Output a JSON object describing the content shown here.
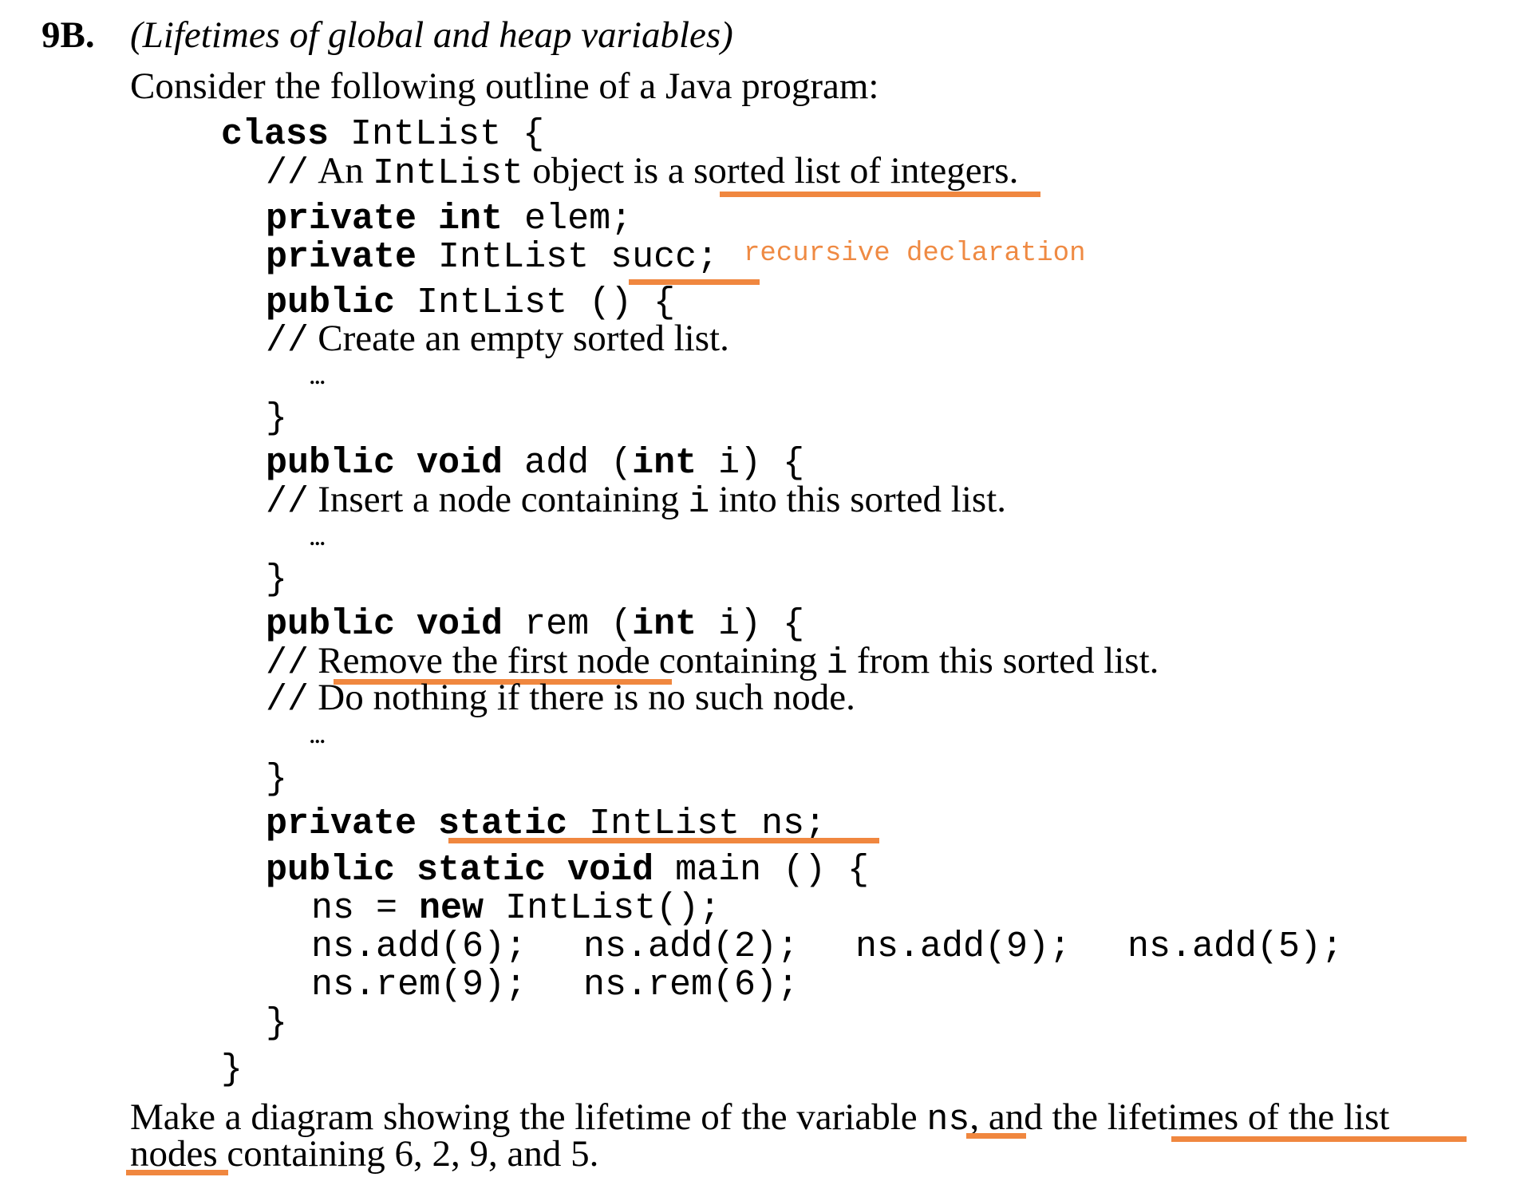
{
  "heading": {
    "number": "9B.",
    "title": "(Lifetimes of global and heap variables)",
    "intro": "Consider the following outline of a Java program:"
  },
  "code": {
    "class_kw": "class",
    "class_name": "IntList {",
    "comment_prefix": "//",
    "class_comment": {
      "a": "An",
      "mono": "IntList",
      "b": "object is a",
      "u": "sorted list of integers."
    },
    "field_elem": {
      "kw": "private int",
      "rest": "elem;"
    },
    "field_succ": {
      "kw": "private",
      "type": "IntList",
      "name": "succ;"
    },
    "annotation_succ": "recursive declaration",
    "ctor": {
      "kw": "public",
      "rest": "IntList () {"
    },
    "ctor_comment": "Create an empty sorted list.",
    "ellipsis": "...",
    "close_brace": "}",
    "add": {
      "kw": "public void",
      "name": "add",
      "lp": "(",
      "param_kw": "int",
      "rest": "i) {"
    },
    "add_comment": {
      "a": "Insert a node containing",
      "mono": "i",
      "b": "into this sorted list."
    },
    "rem": {
      "kw": "public void",
      "name": "rem",
      "lp": "(",
      "param_kw": "int",
      "rest": "i) {"
    },
    "rem_comment1": {
      "u": "Remove the first node",
      "a": "containing",
      "mono": "i",
      "b": "from this sorted list."
    },
    "rem_comment2": "Do nothing if there is no such node.",
    "ns_decl": {
      "kw1": "private",
      "kw2": "static",
      "rest": "IntList ns;"
    },
    "main": {
      "kw": "public static void",
      "rest": "main () {"
    },
    "main_line1": {
      "a": "ns =",
      "kw": "new",
      "b": "IntList();"
    },
    "main_line2": [
      "ns.add(6);",
      "ns.add(2);",
      "ns.add(9);",
      "ns.add(5);"
    ],
    "main_line3": [
      "ns.rem(9);",
      "ns.rem(6);"
    ]
  },
  "question": {
    "l1a": "Make a diagram showing the lifetime of the variable",
    "l1mono": "ns",
    "l1b": ", and the",
    "l1u": "lifetimes of the list",
    "l2u": "nodes",
    "l2b": "containing 6, 2, 9, and 5."
  },
  "colors": {
    "annotation": "#f0873f"
  }
}
